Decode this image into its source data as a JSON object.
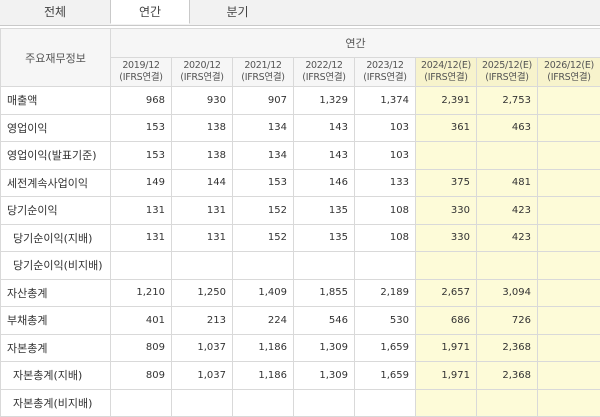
{
  "tabs": [
    "전체",
    "연간",
    "분기"
  ],
  "table": {
    "label_header": "주요재무정보",
    "group_header": "연간",
    "periods": [
      {
        "year": "2019/12",
        "basis": "(IFRS연결)",
        "est": false
      },
      {
        "year": "2020/12",
        "basis": "(IFRS연결)",
        "est": false
      },
      {
        "year": "2021/12",
        "basis": "(IFRS연결)",
        "est": false
      },
      {
        "year": "2022/12",
        "basis": "(IFRS연결)",
        "est": false
      },
      {
        "year": "2023/12",
        "basis": "(IFRS연결)",
        "est": false
      },
      {
        "year": "2024/12(E)",
        "basis": "(IFRS연결)",
        "est": true
      },
      {
        "year": "2025/12(E)",
        "basis": "(IFRS연결)",
        "est": true
      },
      {
        "year": "2026/12(E)",
        "basis": "(IFRS연결)",
        "est": true
      }
    ],
    "rows": [
      {
        "label": "매출액",
        "sub": false,
        "values": [
          "968",
          "930",
          "907",
          "1,329",
          "1,374",
          "2,391",
          "2,753",
          ""
        ]
      },
      {
        "label": "영업이익",
        "sub": false,
        "values": [
          "153",
          "138",
          "134",
          "143",
          "103",
          "361",
          "463",
          ""
        ]
      },
      {
        "label": "영업이익(발표기준)",
        "sub": false,
        "values": [
          "153",
          "138",
          "134",
          "143",
          "103",
          "",
          "",
          ""
        ]
      },
      {
        "label": "세전계속사업이익",
        "sub": false,
        "values": [
          "149",
          "144",
          "153",
          "146",
          "133",
          "375",
          "481",
          ""
        ]
      },
      {
        "label": "당기순이익",
        "sub": false,
        "values": [
          "131",
          "131",
          "152",
          "135",
          "108",
          "330",
          "423",
          ""
        ]
      },
      {
        "label": "당기순이익(지배)",
        "sub": true,
        "values": [
          "131",
          "131",
          "152",
          "135",
          "108",
          "330",
          "423",
          ""
        ]
      },
      {
        "label": "당기순이익(비지배)",
        "sub": true,
        "values": [
          "",
          "",
          "",
          "",
          "",
          "",
          "",
          ""
        ]
      },
      {
        "label": "자산총계",
        "sub": false,
        "values": [
          "1,210",
          "1,250",
          "1,409",
          "1,855",
          "2,189",
          "2,657",
          "3,094",
          ""
        ]
      },
      {
        "label": "부채총계",
        "sub": false,
        "values": [
          "401",
          "213",
          "224",
          "546",
          "530",
          "686",
          "726",
          ""
        ]
      },
      {
        "label": "자본총계",
        "sub": false,
        "values": [
          "809",
          "1,037",
          "1,186",
          "1,309",
          "1,659",
          "1,971",
          "2,368",
          ""
        ]
      },
      {
        "label": "자본총계(지배)",
        "sub": true,
        "values": [
          "809",
          "1,037",
          "1,186",
          "1,309",
          "1,659",
          "1,971",
          "2,368",
          ""
        ]
      },
      {
        "label": "자본총계(비지배)",
        "sub": true,
        "values": [
          "",
          "",
          "",
          "",
          "",
          "",
          "",
          ""
        ]
      }
    ]
  }
}
